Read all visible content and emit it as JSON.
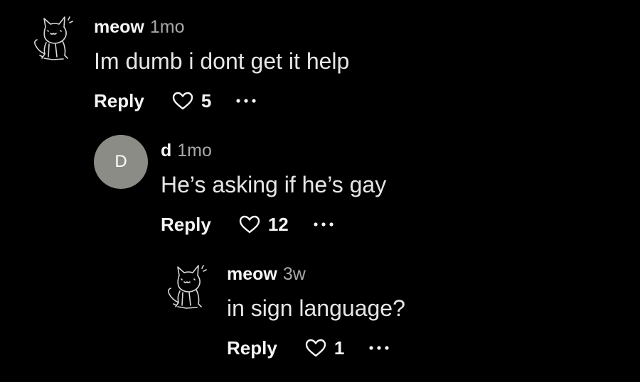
{
  "comments": [
    {
      "username": "meow",
      "time": "1mo",
      "text": "Im dumb i dont get it help",
      "reply_label": "Reply",
      "likes": "5",
      "avatar_type": "cat-sketch-icon"
    },
    {
      "username": "d",
      "time": "1mo",
      "text": "He’s asking if he’s gay",
      "reply_label": "Reply",
      "likes": "12",
      "avatar_letter": "D",
      "avatar_color": "#8c8c86"
    },
    {
      "username": "meow",
      "time": "3w",
      "text": "in sign language?",
      "reply_label": "Reply",
      "likes": "1",
      "avatar_type": "cat-sketch-icon"
    }
  ]
}
